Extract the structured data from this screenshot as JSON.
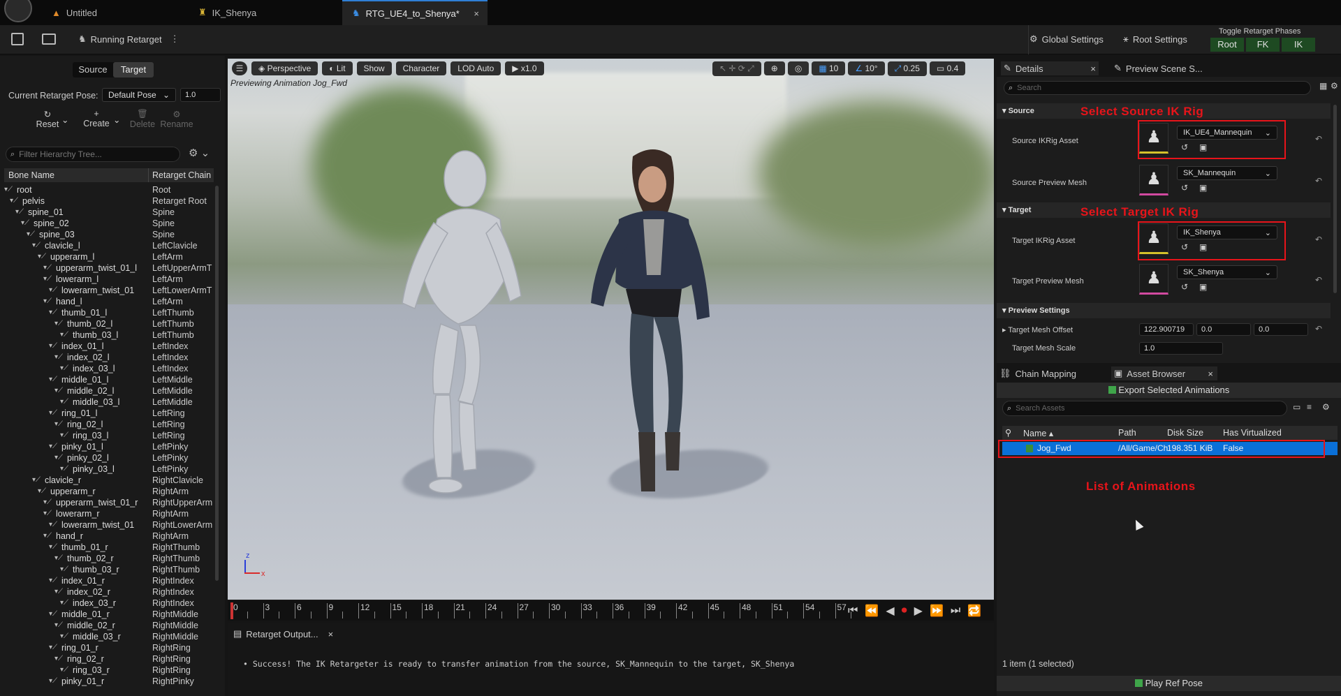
{
  "tabs": [
    {
      "label": "Untitled",
      "icon": "level-icon"
    },
    {
      "label": "IK_Shenya",
      "icon": "ik-rig-icon"
    },
    {
      "label": "RTG_UE4_to_Shenya*",
      "icon": "retargeter-icon",
      "close": "×"
    }
  ],
  "toolbar": {
    "running": "Running Retarget",
    "global": "Global Settings",
    "root": "Root Settings",
    "phases_title": "Toggle Retarget Phases",
    "phases": [
      "Root",
      "FK",
      "IK"
    ]
  },
  "left": {
    "tabs": [
      "Source",
      "Target"
    ],
    "pose_label": "Current Retarget Pose:",
    "pose_value": "Default Pose",
    "pose_blend": "1.0",
    "actions": [
      "Reset",
      "Create",
      "Delete",
      "Rename"
    ],
    "filter_placeholder": "Filter Hierarchy Tree...",
    "col_bone": "Bone Name",
    "col_chain": "Retarget Chain",
    "bones": [
      {
        "n": "root",
        "c": "Root"
      },
      {
        "n": "pelvis",
        "c": "Retarget Root"
      },
      {
        "n": "spine_01",
        "c": "Spine"
      },
      {
        "n": "spine_02",
        "c": "Spine"
      },
      {
        "n": "spine_03",
        "c": "Spine"
      },
      {
        "n": "clavicle_l",
        "c": "LeftClavicle"
      },
      {
        "n": "upperarm_l",
        "c": "LeftArm"
      },
      {
        "n": "upperarm_twist_01_l",
        "c": "LeftUpperArmT"
      },
      {
        "n": "lowerarm_l",
        "c": "LeftArm"
      },
      {
        "n": "lowerarm_twist_01",
        "c": "LeftLowerArmT"
      },
      {
        "n": "hand_l",
        "c": "LeftArm"
      },
      {
        "n": "thumb_01_l",
        "c": "LeftThumb"
      },
      {
        "n": "thumb_02_l",
        "c": "LeftThumb"
      },
      {
        "n": "thumb_03_l",
        "c": "LeftThumb"
      },
      {
        "n": "index_01_l",
        "c": "LeftIndex"
      },
      {
        "n": "index_02_l",
        "c": "LeftIndex"
      },
      {
        "n": "index_03_l",
        "c": "LeftIndex"
      },
      {
        "n": "middle_01_l",
        "c": "LeftMiddle"
      },
      {
        "n": "middle_02_l",
        "c": "LeftMiddle"
      },
      {
        "n": "middle_03_l",
        "c": "LeftMiddle"
      },
      {
        "n": "ring_01_l",
        "c": "LeftRing"
      },
      {
        "n": "ring_02_l",
        "c": "LeftRing"
      },
      {
        "n": "ring_03_l",
        "c": "LeftRing"
      },
      {
        "n": "pinky_01_l",
        "c": "LeftPinky"
      },
      {
        "n": "pinky_02_l",
        "c": "LeftPinky"
      },
      {
        "n": "pinky_03_l",
        "c": "LeftPinky"
      },
      {
        "n": "clavicle_r",
        "c": "RightClavicle"
      },
      {
        "n": "upperarm_r",
        "c": "RightArm"
      },
      {
        "n": "upperarm_twist_01_r",
        "c": "RightUpperArm"
      },
      {
        "n": "lowerarm_r",
        "c": "RightArm"
      },
      {
        "n": "lowerarm_twist_01",
        "c": "RightLowerArm"
      },
      {
        "n": "hand_r",
        "c": "RightArm"
      },
      {
        "n": "thumb_01_r",
        "c": "RightThumb"
      },
      {
        "n": "thumb_02_r",
        "c": "RightThumb"
      },
      {
        "n": "thumb_03_r",
        "c": "RightThumb"
      },
      {
        "n": "index_01_r",
        "c": "RightIndex"
      },
      {
        "n": "index_02_r",
        "c": "RightIndex"
      },
      {
        "n": "index_03_r",
        "c": "RightIndex"
      },
      {
        "n": "middle_01_r",
        "c": "RightMiddle"
      },
      {
        "n": "middle_02_r",
        "c": "RightMiddle"
      },
      {
        "n": "middle_03_r",
        "c": "RightMiddle"
      },
      {
        "n": "ring_01_r",
        "c": "RightRing"
      },
      {
        "n": "ring_02_r",
        "c": "RightRing"
      },
      {
        "n": "ring_03_r",
        "c": "RightRing"
      },
      {
        "n": "pinky_01_r",
        "c": "RightPinky"
      }
    ]
  },
  "viewport": {
    "buttons": [
      "Perspective",
      "Lit",
      "Show",
      "Character",
      "LOD Auto",
      "x1.0"
    ],
    "right_values": [
      "10",
      "10°",
      "0.25",
      "0.4"
    ],
    "previewing": "Previewing Animation Jog_Fwd",
    "axis_z": "z",
    "axis_x": "x"
  },
  "timeline": {
    "ticks": [
      "0",
      "3",
      "6",
      "9",
      "12",
      "15",
      "18",
      "21",
      "24",
      "27",
      "30",
      "33",
      "36",
      "39",
      "42",
      "45",
      "48",
      "51",
      "54",
      "57"
    ]
  },
  "output": {
    "tab": "Retarget Output...",
    "close": "×",
    "message": "Success! The IK Retargeter is ready to transfer animation from the source, SK_Mannequin to the target, SK_Shenya"
  },
  "details": {
    "tab": "Details",
    "close": "×",
    "preview_tab": "Preview Scene S...",
    "search_placeholder": "Search",
    "source_section": "Source",
    "source_ikrig_label": "Source IKRig Asset",
    "source_ikrig_value": "IK_UE4_Mannequin",
    "source_mesh_label": "Source Preview Mesh",
    "source_mesh_value": "SK_Mannequin",
    "target_section": "Target",
    "target_ikrig_label": "Target IKRig Asset",
    "target_ikrig_value": "IK_Shenya",
    "target_mesh_label": "Target Preview Mesh",
    "target_mesh_value": "SK_Shenya",
    "preview_section": "Preview Settings",
    "offset_label": "Target Mesh Offset",
    "offset_values": [
      "122.900719",
      "0.0",
      "0.0"
    ],
    "scale_label": "Target Mesh Scale",
    "scale_value": "1.0"
  },
  "annotations": {
    "source": "Select Source IK Rig",
    "target": "Select Target IK Rig",
    "animations": "List of Animations"
  },
  "asset_browser": {
    "tab_chain": "Chain Mapping",
    "tab_assets": "Asset Browser",
    "close": "×",
    "export": "Export Selected Animations",
    "search_placeholder": "Search Assets",
    "cols": [
      "Name",
      "Path",
      "Disk Size",
      "Has Virtualized"
    ],
    "row": {
      "name": "Jog_Fwd",
      "path": "/All/Game/Ch",
      "size": "198.351 KiB",
      "virt": "False"
    },
    "status": "1 item (1 selected)",
    "play": "Play Ref Pose"
  }
}
